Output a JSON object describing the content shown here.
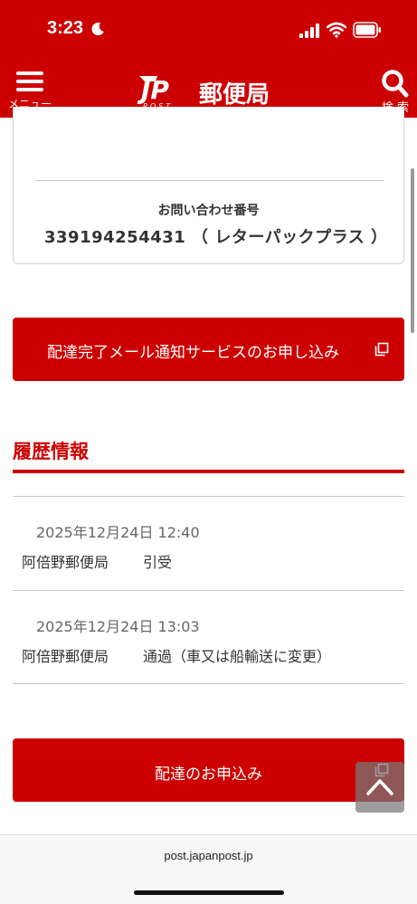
{
  "status_bar": {
    "time": "3:23"
  },
  "header": {
    "menu_label": "メニュー",
    "logo_text": "郵便局",
    "logo_mark_text": "JP",
    "logo_sub_text": "POST",
    "search_label": "検 索",
    "background_color": "#cc0000"
  },
  "tracking": {
    "inquiry_label": "お問い合わせ番号",
    "inquiry_number": "339194254431 （ レターパックプラス ）"
  },
  "notify_button": {
    "label": "配達完了メール通知サービスのお申し込み",
    "icon": "external-window-icon"
  },
  "history": {
    "title": "履歴情報",
    "entries": [
      {
        "datetime": "2025年12月24日 12:40",
        "office": "阿倍野郵便局",
        "status": "引受"
      },
      {
        "datetime": "2025年12月24日 13:03",
        "office": "阿倍野郵便局",
        "status": "通過（車又は船輸送に変更）"
      }
    ]
  },
  "apply_button": {
    "label": "配達のお申込み",
    "icon": "external-window-icon"
  },
  "back_to_top": {
    "icon": "chevron-up-icon"
  },
  "browser": {
    "url": "post.japanpost.jp"
  },
  "colors": {
    "accent": "#cc0000",
    "divider": "#c8c8c8",
    "text": "#333333"
  }
}
